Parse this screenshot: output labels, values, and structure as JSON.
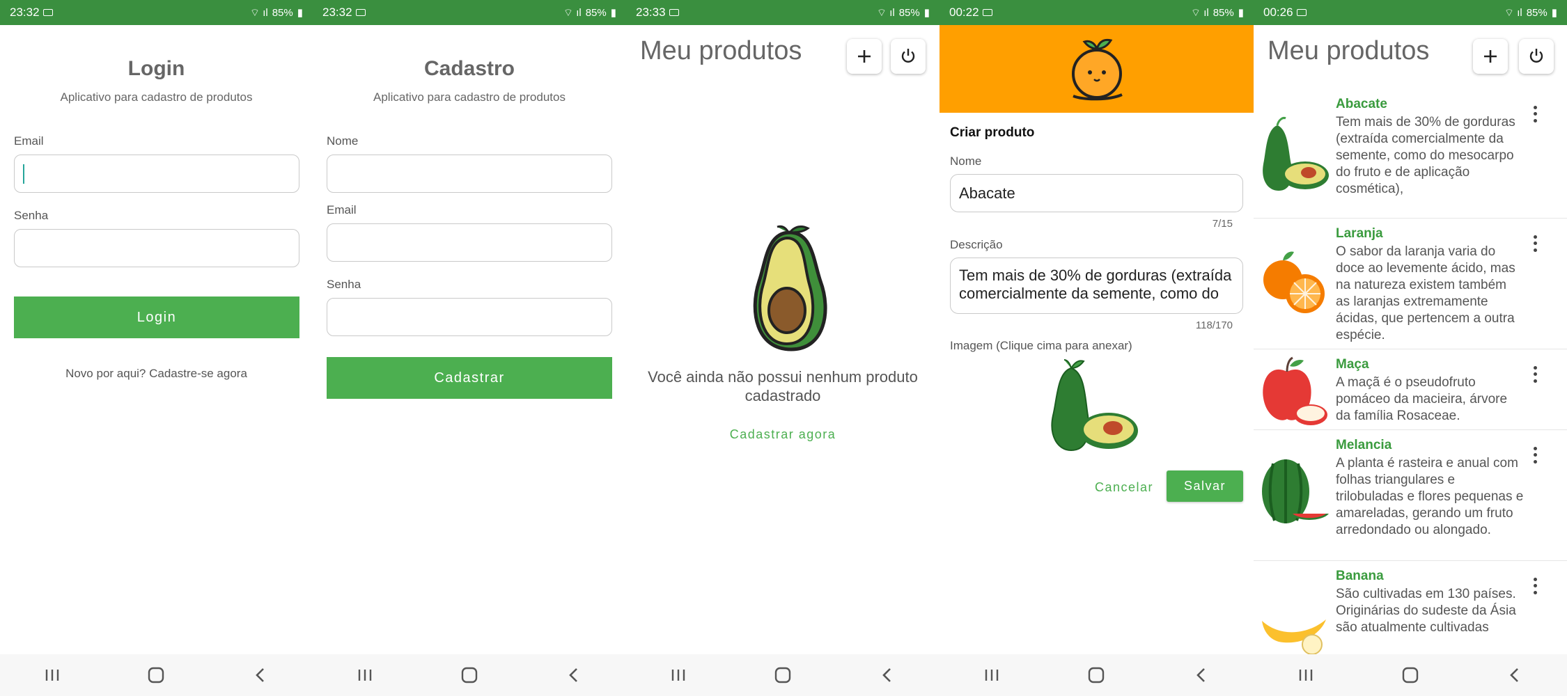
{
  "status": {
    "battery": "85%",
    "times": [
      "23:32",
      "23:32",
      "23:33",
      "00:22",
      "00:26"
    ]
  },
  "colors": {
    "accent": "#4caf50",
    "status_bar": "#3a8f3f",
    "header_orange": "#ff9f00",
    "product_name": "#3a9b3e"
  },
  "login": {
    "title": "Login",
    "subtitle": "Aplicativo para cadastro de produtos",
    "email_label": "Email",
    "password_label": "Senha",
    "login_button": "Login",
    "signup_link": "Novo por aqui? Cadastre-se agora"
  },
  "register": {
    "title": "Cadastro",
    "subtitle": "Aplicativo para cadastro de produtos",
    "name_label": "Nome",
    "email_label": "Email",
    "password_label": "Senha",
    "submit_button": "Cadastrar"
  },
  "empty": {
    "title": "Meu produtos",
    "message": "Você ainda não possui nenhum produto cadastrado",
    "cta": "Cadastrar agora"
  },
  "create": {
    "heading": "Criar produto",
    "name_label": "Nome",
    "name_value": "Abacate",
    "name_counter": "7/15",
    "desc_label": "Descrição",
    "desc_value": "Tem mais de 30% de gorduras (extraída comercialmente da semente, como do",
    "desc_counter": "118/170",
    "image_label": "Imagem (Clique cima para anexar)",
    "cancel": "Cancelar",
    "save": "Salvar"
  },
  "list": {
    "title": "Meu produtos",
    "products": [
      {
        "name": "Abacate",
        "description": "Tem mais de 30% de gorduras (extraída comercialmente da semente, como do mesocarpo do fruto e de aplicação cosmética),",
        "icon": "avocado-icon"
      },
      {
        "name": "Laranja",
        "description": "O sabor da laranja varia do doce ao levemente ácido, mas na natureza existem também as laranjas extremamente ácidas, que pertencem a outra espécie.",
        "icon": "orange-icon"
      },
      {
        "name": "Maça",
        "description": "A maçã é o pseudofruto pomáceo da macieira, árvore da família Rosaceae.",
        "icon": "apple-icon"
      },
      {
        "name": "Melancia",
        "description": "A planta é rasteira e anual com folhas triangulares e trilobuladas e flores pequenas e amareladas, gerando um fruto arredondado ou alongado.",
        "icon": "watermelon-icon"
      },
      {
        "name": "Banana",
        "description": "São cultivadas em 130 países. Originárias do sudeste da Ásia são atualmente cultivadas",
        "icon": "banana-icon"
      }
    ]
  }
}
